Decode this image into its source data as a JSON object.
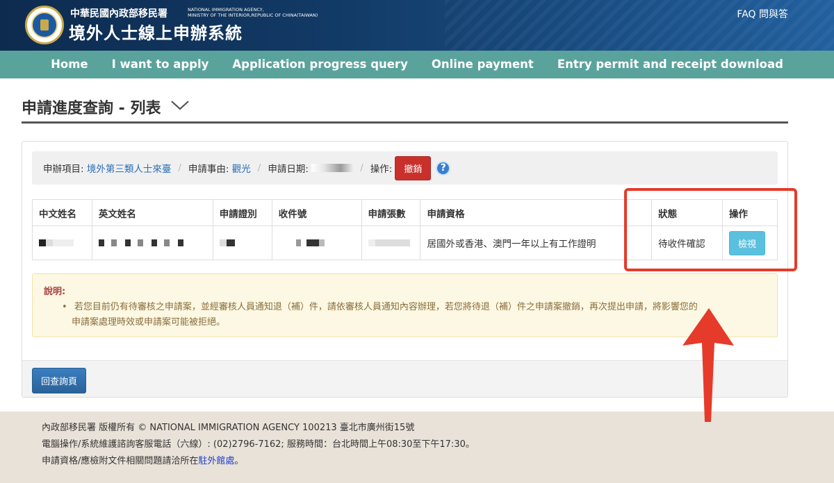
{
  "header": {
    "agency_zh": "中華民國內政部移民署",
    "agency_en_line1": "NATIONAL IMMIGRATION AGENCY,",
    "agency_en_line2": "MINISTRY OF THE INTERIOR,REPUBLIC OF CHINA(TAIWAN)",
    "system_title": "境外人士線上申辦系統",
    "faq": "FAQ 問與答"
  },
  "nav": {
    "items": [
      "Home",
      "I want to apply",
      "Application progress query",
      "Online payment",
      "Entry permit and receipt download"
    ]
  },
  "page": {
    "title": "申請進度查詢 - 列表"
  },
  "infobar": {
    "item_label": "申辦項目:",
    "item_value": "境外第三類人士來臺",
    "reason_label": "申請事由:",
    "reason_value": "觀光",
    "date_label": "申請日期:",
    "action_label": "操作:",
    "revoke_button": "撤銷",
    "help_icon": "?"
  },
  "table": {
    "headers": [
      "中文姓名",
      "英文姓名",
      "申請證別",
      "收件號",
      "申請張數",
      "申請資格",
      "狀態",
      "操作"
    ],
    "row": {
      "qualification": "居國外或香港、澳門一年以上有工作證明",
      "status": "待收件確認",
      "view_button": "檢視"
    }
  },
  "note": {
    "title": "說明:",
    "item_line1": "若您目前仍有待審核之申請案，並經審核人員通知退（補）件，請依審核人員通知內容辦理，若您將待退（補）件之申請案撤銷，再次提出申請，將影響您的",
    "item_line2": "申請案處理時效或申請案可能被拒絕。"
  },
  "panel_footer": {
    "back_button": "回查詢頁"
  },
  "footer": {
    "line1": "內政部移民署 版權所有 © NATIONAL IMMIGRATION AGENCY 100213 臺北市廣州街15號",
    "line2": "電腦操作/系統維護諮詢客服電話（六線）: (02)2796-7162; 服務時間：台北時間上午08:30至下午17:30。",
    "line3_prefix": "申請資格/應檢附文件相關問題請洽所在",
    "line3_link": "駐外館處",
    "line3_suffix": "。"
  },
  "colors": {
    "nav_bg": "#5aa39c",
    "header_bg": "#123a66",
    "revoke_btn": "#c9302c",
    "view_btn": "#5bc0de",
    "back_btn": "#2e6da4",
    "annotation": "#e63a2a",
    "note_bg": "#fcf8e3"
  }
}
